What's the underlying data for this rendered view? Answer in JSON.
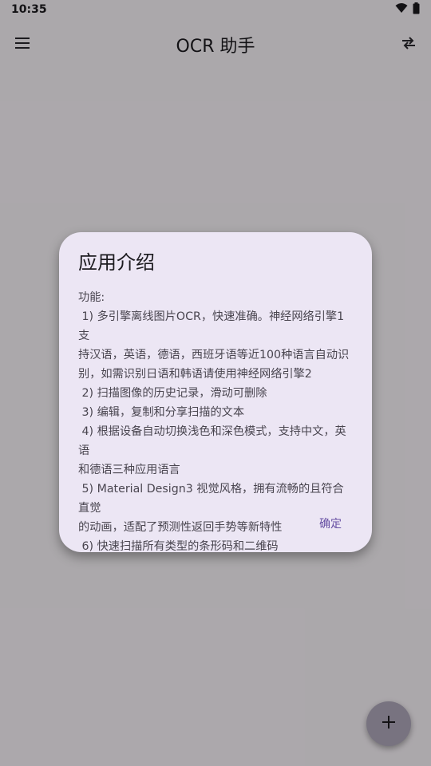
{
  "status_bar": {
    "time": "10:35",
    "icons": [
      "wifi-icon",
      "battery-icon"
    ]
  },
  "app_bar": {
    "title": "OCR 助手",
    "left_icon": "menu-icon",
    "right_icon": "swap-icon"
  },
  "dialog": {
    "title": "应用介绍",
    "body_lines": [
      "功能:",
      " 1) 多引擎离线图片OCR，快速准确。神经网络引擎1支",
      "持汉语，英语，德语，西班牙语等近100种语言自动识",
      "别，如需识别日语和韩语请使用神经网络引擎2",
      " 2) 扫描图像的历史记录，滑动可删除",
      " 3) 编辑，复制和分享扫描的文本",
      " 4) 根据设备自动切换浅色和深色模式，支持中文，英语",
      "和德语三种应用语言",
      " 5) Material Design3 视觉风格，拥有流畅的且符合直觉",
      "的动画，适配了预测性返回手势等新特性",
      " 6) 快速扫描所有类型的条形码和二维码"
    ],
    "confirm_label": "确定"
  },
  "fab": {
    "icon": "plus-icon"
  },
  "colors": {
    "background": "#fdf8fd",
    "dialog_surface": "#ece6f4",
    "accent": "#6750a4",
    "fab": "#b1aabd"
  }
}
